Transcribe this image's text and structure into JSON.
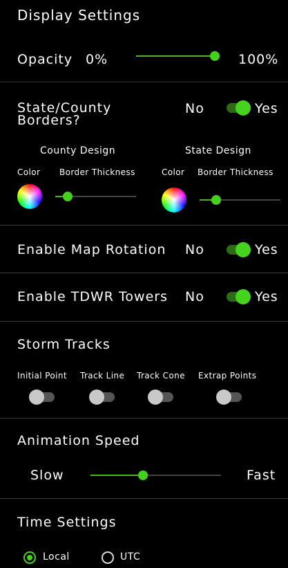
{
  "display": {
    "title": "Display Settings",
    "opacity_label": "Opacity",
    "opacity_min": "0%",
    "opacity_max": "100%",
    "opacity_value": 1.0
  },
  "borders": {
    "title_line1": "State/County",
    "title_line2": "Borders?",
    "no": "No",
    "yes": "Yes",
    "enabled": true,
    "county_design": "County Design",
    "state_design": "State Design",
    "color_label": "Color",
    "thickness_label": "Border Thickness",
    "county_thickness": 0.15,
    "state_thickness": 0.2
  },
  "rotation": {
    "label": "Enable Map Rotation",
    "no": "No",
    "yes": "Yes",
    "enabled": true
  },
  "tdwr": {
    "label": "Enable TDWR Towers",
    "no": "No",
    "yes": "Yes",
    "enabled": true
  },
  "storm": {
    "title": "Storm Tracks",
    "options": [
      {
        "label": "Initial Point",
        "enabled": false
      },
      {
        "label": "Track Line",
        "enabled": false
      },
      {
        "label": "Track Cone",
        "enabled": false
      },
      {
        "label": "Extrap Points",
        "enabled": false
      }
    ]
  },
  "animation": {
    "title": "Animation Speed",
    "slow": "Slow",
    "fast": "Fast",
    "value": 0.4
  },
  "time": {
    "title": "Time Settings",
    "local": "Local",
    "utc": "UTC",
    "selected": "Local"
  },
  "colors": {
    "accent": "#46d31d",
    "background": "#000000",
    "divider": "#3a3a3a"
  }
}
